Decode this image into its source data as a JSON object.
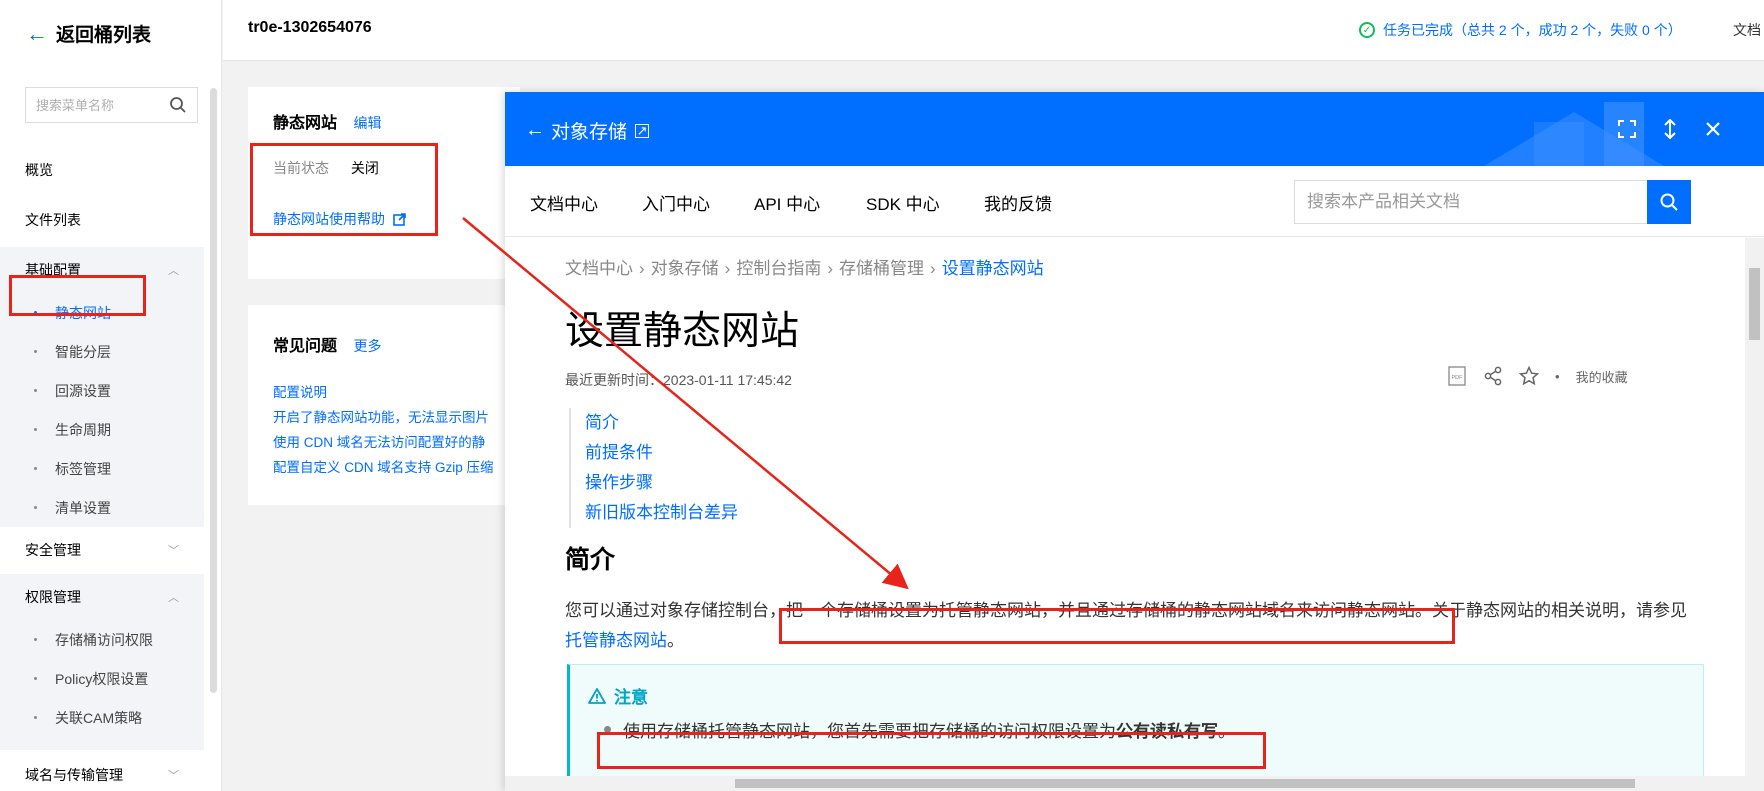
{
  "sidebar": {
    "back_label": "返回桶列表",
    "search_placeholder": "搜索菜单名称",
    "overview": "概览",
    "file_list": "文件列表",
    "basic_config": {
      "label": "基础配置",
      "items": [
        "静态网站",
        "智能分层",
        "回源设置",
        "生命周期",
        "标签管理",
        "清单设置"
      ]
    },
    "security": "安全管理",
    "permissions": {
      "label": "权限管理",
      "items": [
        "存储桶访问权限",
        "Policy权限设置",
        "关联CAM策略"
      ]
    },
    "domain_transfer": "域名与传输管理"
  },
  "topbar": {
    "bucket_name": "tr0e-1302654076",
    "task_status": "任务已完成（总共 2 个，成功 2 个，失败 0 个）",
    "doc_label": "文档"
  },
  "static_card": {
    "title": "静态网站",
    "edit": "编辑",
    "status_label": "当前状态",
    "status_value": "关闭",
    "help_link": "静态网站使用帮助"
  },
  "faq_card": {
    "title": "常见问题",
    "more": "更多",
    "links": [
      "配置说明",
      "开启了静态网站功能，无法显示图片",
      "使用 CDN 域名无法访问配置好的静",
      "配置自定义 CDN 域名支持 Gzip 压缩"
    ]
  },
  "doc_panel": {
    "back_title": "对象存储",
    "nav": [
      "文档中心",
      "入门中心",
      "API 中心",
      "SDK 中心",
      "我的反馈"
    ],
    "search_placeholder": "搜索本产品相关文档",
    "breadcrumb": [
      "文档中心",
      "对象存储",
      "控制台指南",
      "存储桶管理",
      "设置静态网站"
    ],
    "title": "设置静态网站",
    "updated": "最近更新时间：2023-01-11 17:45:42",
    "pdf_label": "PDF",
    "favorite_label": "我的收藏",
    "toc": [
      "简介",
      "前提条件",
      "操作步骤",
      "新旧版本控制台差异"
    ],
    "section_title": "简介",
    "para_before": "您可以通过对象存储控制台，",
    "para_highlight": "把一个存储桶设置为托管静态网站，并且通过存储桶的静态网站域名来访问静态网站。",
    "para_after": "关于静态网站的相关说明，请参见",
    "para_link": "托管静态网站",
    "para_end": "。",
    "note_title": "注意",
    "note_text": "使用存储桶托管静态网站，您首先需要把存储桶的访问权限设置为",
    "note_bold": "公有读私有写",
    "note_end": "。"
  },
  "colors": {
    "brand_blue": "#006eff",
    "annotation_red": "#e8231b",
    "success_green": "#0abf5b",
    "note_cyan": "#00a4c4"
  }
}
